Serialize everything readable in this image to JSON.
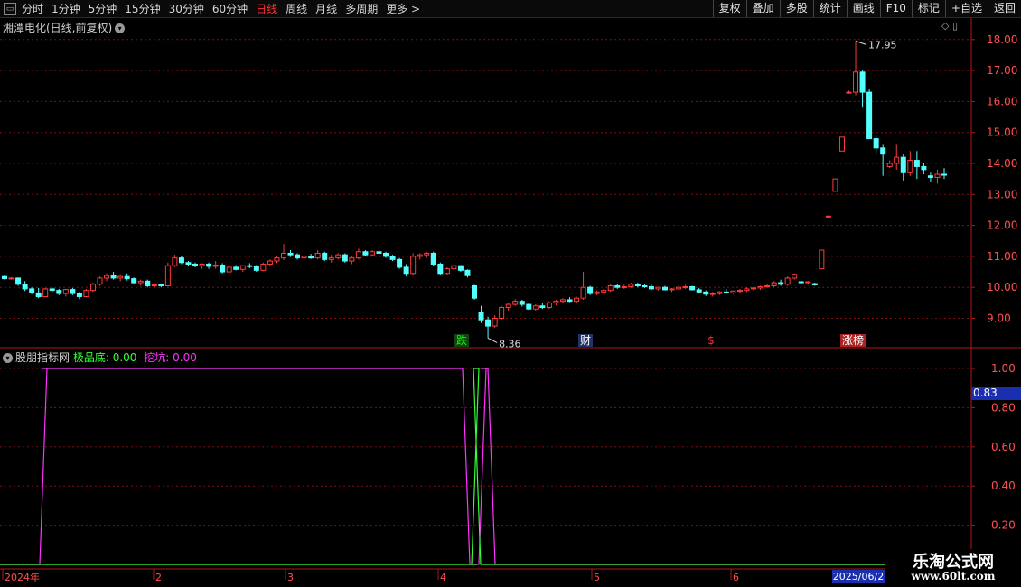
{
  "toolbar": {
    "periods": [
      {
        "label": "分时"
      },
      {
        "label": "1分钟"
      },
      {
        "label": "5分钟"
      },
      {
        "label": "15分钟"
      },
      {
        "label": "30分钟"
      },
      {
        "label": "60分钟"
      },
      {
        "label": "日线"
      },
      {
        "label": "周线"
      },
      {
        "label": "月线"
      },
      {
        "label": "多周期"
      },
      {
        "label": "更多 >"
      }
    ],
    "active_period": "日线",
    "right_buttons": [
      {
        "label": "复权"
      },
      {
        "label": "叠加"
      },
      {
        "label": "多股"
      },
      {
        "label": "统计"
      },
      {
        "label": "画线"
      },
      {
        "label": "F10"
      },
      {
        "label": "标记"
      },
      {
        "label": "+自选"
      },
      {
        "label": "返回"
      }
    ]
  },
  "stock": {
    "title": "湘潭电化(日线,前复权)"
  },
  "price_axis": {
    "ticks": [
      "18.00",
      "17.00",
      "16.00",
      "15.00",
      "14.00",
      "13.00",
      "12.00",
      "11.00",
      "10.00",
      "9.00"
    ]
  },
  "annotations": {
    "high_label": "17.95",
    "low_label": "8.36"
  },
  "markers": [
    {
      "text": "跌",
      "color": "#00ff00",
      "bg": "#114411"
    },
    {
      "text": "财",
      "color": "#ffffff",
      "bg": "#223366"
    },
    {
      "text": "$",
      "color": "#ff3030",
      "bg": "#000000"
    },
    {
      "text": "涨榜",
      "color": "#ffffff",
      "bg": "#aa2222"
    }
  ],
  "indicator": {
    "name": "股朋指标网",
    "line1_label": "极品底:",
    "line1_value": "0.00",
    "line1_color": "#33ff33",
    "line2_label": "挖坑:",
    "line2_value": "0.00",
    "line2_color": "#ff33ff",
    "axis_ticks": [
      "1.00",
      "0.80",
      "0.60",
      "0.40",
      "0.20"
    ],
    "cursor_value": "0.83"
  },
  "time_axis": {
    "labels": [
      "2024年",
      "2",
      "3",
      "4",
      "5",
      "6"
    ],
    "cursor_date": "2025/06/2"
  },
  "watermark": {
    "title": "乐淘公式网",
    "url": "www.60lt.com"
  },
  "colors": {
    "up": "#ff3a3a",
    "down": "#54ffff",
    "grid": "#7a1010",
    "axis": "#b01818"
  },
  "chart_data": {
    "type": "candlestick",
    "price_range": [
      8.0,
      18.3
    ],
    "candles": [
      [
        10.35,
        10.38,
        10.25,
        10.28
      ],
      [
        10.28,
        10.33,
        10.25,
        10.3
      ],
      [
        10.3,
        10.32,
        10.05,
        10.1
      ],
      [
        10.1,
        10.2,
        9.88,
        9.95
      ],
      [
        9.95,
        10.0,
        9.78,
        9.82
      ],
      [
        9.82,
        9.98,
        9.65,
        9.7
      ],
      [
        9.7,
        9.98,
        9.68,
        9.95
      ],
      [
        9.95,
        10.0,
        9.85,
        9.9
      ],
      [
        9.9,
        9.95,
        9.75,
        9.8
      ],
      [
        9.8,
        9.95,
        9.7,
        9.93
      ],
      [
        9.93,
        9.98,
        9.75,
        9.8
      ],
      [
        9.8,
        9.85,
        9.62,
        9.7
      ],
      [
        9.7,
        9.95,
        9.68,
        9.9
      ],
      [
        9.9,
        10.15,
        9.85,
        10.1
      ],
      [
        10.1,
        10.35,
        10.05,
        10.3
      ],
      [
        10.3,
        10.45,
        10.2,
        10.38
      ],
      [
        10.38,
        10.5,
        10.25,
        10.3
      ],
      [
        10.3,
        10.42,
        10.2,
        10.35
      ],
      [
        10.35,
        10.45,
        10.22,
        10.28
      ],
      [
        10.28,
        10.32,
        10.1,
        10.15
      ],
      [
        10.15,
        10.25,
        10.05,
        10.2
      ],
      [
        10.2,
        10.25,
        10.0,
        10.05
      ],
      [
        10.05,
        10.12,
        10.0,
        10.08
      ],
      [
        10.08,
        10.12,
        10.0,
        10.05
      ],
      [
        10.05,
        10.8,
        10.03,
        10.7
      ],
      [
        10.7,
        11.05,
        10.65,
        10.95
      ],
      [
        10.95,
        11.0,
        10.75,
        10.8
      ],
      [
        10.8,
        10.85,
        10.7,
        10.75
      ],
      [
        10.75,
        10.8,
        10.65,
        10.7
      ],
      [
        10.7,
        10.78,
        10.6,
        10.75
      ],
      [
        10.75,
        10.8,
        10.6,
        10.68
      ],
      [
        10.68,
        10.85,
        10.6,
        10.72
      ],
      [
        10.72,
        10.78,
        10.45,
        10.5
      ],
      [
        10.5,
        10.7,
        10.45,
        10.65
      ],
      [
        10.65,
        10.72,
        10.55,
        10.58
      ],
      [
        10.58,
        10.72,
        10.5,
        10.7
      ],
      [
        10.7,
        10.78,
        10.62,
        10.68
      ],
      [
        10.68,
        10.72,
        10.5,
        10.55
      ],
      [
        10.55,
        10.8,
        10.52,
        10.75
      ],
      [
        10.75,
        10.9,
        10.7,
        10.85
      ],
      [
        10.85,
        11.0,
        10.78,
        10.95
      ],
      [
        10.95,
        11.4,
        10.88,
        11.1
      ],
      [
        11.1,
        11.2,
        10.98,
        11.05
      ],
      [
        11.05,
        11.1,
        10.9,
        10.95
      ],
      [
        10.95,
        11.05,
        10.88,
        11.0
      ],
      [
        11.0,
        11.08,
        10.92,
        10.95
      ],
      [
        10.95,
        11.2,
        10.9,
        11.1
      ],
      [
        11.1,
        11.15,
        10.85,
        10.9
      ],
      [
        10.9,
        11.05,
        10.8,
        10.95
      ],
      [
        10.95,
        11.1,
        10.9,
        11.05
      ],
      [
        11.05,
        11.1,
        10.8,
        10.85
      ],
      [
        10.85,
        11.0,
        10.75,
        10.95
      ],
      [
        10.95,
        11.25,
        10.9,
        11.15
      ],
      [
        11.15,
        11.2,
        11.0,
        11.05
      ],
      [
        11.05,
        11.2,
        11.0,
        11.15
      ],
      [
        11.15,
        11.18,
        11.05,
        11.1
      ],
      [
        11.1,
        11.15,
        10.95,
        11.0
      ],
      [
        11.0,
        11.05,
        10.85,
        10.9
      ],
      [
        10.9,
        10.95,
        10.6,
        10.65
      ],
      [
        10.65,
        10.75,
        10.35,
        10.45
      ],
      [
        10.45,
        11.1,
        10.4,
        11.0
      ],
      [
        11.0,
        11.1,
        10.9,
        11.05
      ],
      [
        11.05,
        11.15,
        10.95,
        11.1
      ],
      [
        11.1,
        11.15,
        10.7,
        10.75
      ],
      [
        10.75,
        10.8,
        10.4,
        10.45
      ],
      [
        10.45,
        10.65,
        10.4,
        10.6
      ],
      [
        10.6,
        10.75,
        10.55,
        10.7
      ],
      [
        10.7,
        10.72,
        10.5,
        10.55
      ],
      [
        10.55,
        10.58,
        10.32,
        10.38
      ],
      [
        10.05,
        10.08,
        9.6,
        9.65
      ],
      [
        9.2,
        9.4,
        8.85,
        8.95
      ],
      [
        8.95,
        9.05,
        8.36,
        8.75
      ],
      [
        8.75,
        9.1,
        8.7,
        9.0
      ],
      [
        9.0,
        9.4,
        8.95,
        9.35
      ],
      [
        9.35,
        9.5,
        9.25,
        9.45
      ],
      [
        9.45,
        9.62,
        9.4,
        9.55
      ],
      [
        9.55,
        9.6,
        9.38,
        9.45
      ],
      [
        9.45,
        9.5,
        9.25,
        9.3
      ],
      [
        9.3,
        9.45,
        9.25,
        9.4
      ],
      [
        9.4,
        9.5,
        9.3,
        9.35
      ],
      [
        9.35,
        9.55,
        9.3,
        9.5
      ],
      [
        9.5,
        9.6,
        9.42,
        9.55
      ],
      [
        9.55,
        9.65,
        9.48,
        9.6
      ],
      [
        9.6,
        9.68,
        9.52,
        9.55
      ],
      [
        9.55,
        9.7,
        9.5,
        9.65
      ],
      [
        9.65,
        10.5,
        9.6,
        10.0
      ],
      [
        10.0,
        10.05,
        9.75,
        9.8
      ],
      [
        9.8,
        9.9,
        9.75,
        9.85
      ],
      [
        9.85,
        9.95,
        9.8,
        9.9
      ],
      [
        9.9,
        10.1,
        9.85,
        10.05
      ],
      [
        10.05,
        10.1,
        9.95,
        10.0
      ],
      [
        10.0,
        10.08,
        9.95,
        10.02
      ],
      [
        10.02,
        10.15,
        9.98,
        10.1
      ],
      [
        10.1,
        10.15,
        10.0,
        10.05
      ],
      [
        10.05,
        10.1,
        9.98,
        10.02
      ],
      [
        10.02,
        10.08,
        9.92,
        9.95
      ],
      [
        9.95,
        10.02,
        9.9,
        10.0
      ],
      [
        10.0,
        10.05,
        9.9,
        9.92
      ],
      [
        9.92,
        9.98,
        9.85,
        9.95
      ],
      [
        9.95,
        10.05,
        9.92,
        10.0
      ],
      [
        10.0,
        10.08,
        9.95,
        10.02
      ],
      [
        10.02,
        10.05,
        9.9,
        9.92
      ],
      [
        9.92,
        9.98,
        9.8,
        9.85
      ],
      [
        9.85,
        9.9,
        9.72,
        9.78
      ],
      [
        9.78,
        9.85,
        9.7,
        9.8
      ],
      [
        9.8,
        9.88,
        9.75,
        9.85
      ],
      [
        9.85,
        9.95,
        9.8,
        9.82
      ],
      [
        9.82,
        9.9,
        9.78,
        9.88
      ],
      [
        9.88,
        9.95,
        9.82,
        9.9
      ],
      [
        9.9,
        10.0,
        9.85,
        9.95
      ],
      [
        9.95,
        10.02,
        9.9,
        9.98
      ],
      [
        9.98,
        10.05,
        9.92,
        10.02
      ],
      [
        10.02,
        10.1,
        9.98,
        10.05
      ],
      [
        10.05,
        10.2,
        10.0,
        10.15
      ],
      [
        10.15,
        10.25,
        10.05,
        10.1
      ],
      [
        10.1,
        10.35,
        10.05,
        10.3
      ],
      [
        10.3,
        10.45,
        10.25,
        10.42
      ],
      [
        10.18,
        10.22,
        10.1,
        10.15
      ],
      [
        10.15,
        10.2,
        10.08,
        10.18
      ],
      [
        10.12,
        10.15,
        10.05,
        10.08
      ],
      [
        10.6,
        11.2,
        10.6,
        11.2
      ],
      [
        12.3,
        12.32,
        12.28,
        12.3
      ],
      [
        13.1,
        13.5,
        13.1,
        13.5
      ],
      [
        14.4,
        14.85,
        14.4,
        14.85
      ],
      [
        16.3,
        16.35,
        16.25,
        16.3
      ],
      [
        16.3,
        17.95,
        16.2,
        16.95
      ],
      [
        16.95,
        17.0,
        15.8,
        16.3
      ],
      [
        16.3,
        16.4,
        14.8,
        14.8
      ],
      [
        14.8,
        14.9,
        14.3,
        14.5
      ],
      [
        14.5,
        14.6,
        13.6,
        14.3
      ],
      [
        13.9,
        14.1,
        13.85,
        14.0
      ],
      [
        14.0,
        14.6,
        13.8,
        14.2
      ],
      [
        14.2,
        14.3,
        13.45,
        13.7
      ],
      [
        13.7,
        14.4,
        13.6,
        14.1
      ],
      [
        14.1,
        14.4,
        13.5,
        13.9
      ],
      [
        13.9,
        14.0,
        13.65,
        13.8
      ],
      [
        13.6,
        13.7,
        13.4,
        13.55
      ],
      [
        13.55,
        13.8,
        13.35,
        13.65
      ],
      [
        13.65,
        13.85,
        13.5,
        13.62
      ]
    ],
    "indicator_series": [
      {
        "name": "极品底",
        "points": [
          [
            528,
            0
          ],
          [
            530,
            1
          ],
          [
            532,
            0
          ]
        ]
      },
      {
        "name": "挖坑",
        "points": [
          [
            52,
            1
          ],
          [
            54,
            1
          ],
          [
            520,
            0
          ],
          [
            538,
            1
          ],
          [
            540,
            1
          ]
        ]
      }
    ]
  }
}
